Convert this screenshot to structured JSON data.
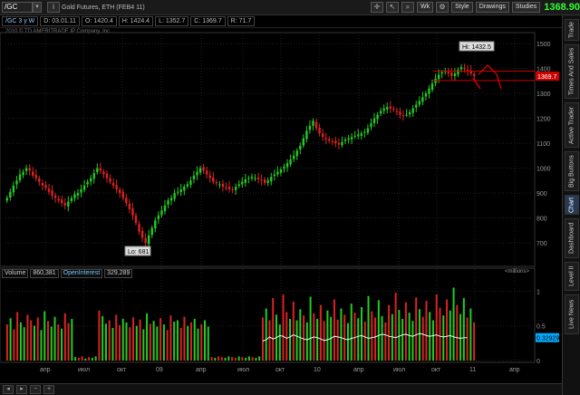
{
  "toolbar": {
    "symbol": "/GC",
    "description": "Gold Futures, ETH (FEB4 11)",
    "period_button": "Wk",
    "style_label": "Style",
    "drawings_label": "Drawings",
    "studies_label": "Studies",
    "last_price": "1368.90",
    "last_price_color": "#33ff33"
  },
  "ohlc": {
    "timeframe": "/GC 3 y W",
    "date": "D: 03.01.11",
    "open": "O: 1420.4",
    "high": "H: 1424.4",
    "low": "L: 1352.7",
    "close": "C: 1369.7",
    "range": "R: 71.7"
  },
  "copyright": "2010 © TD AMERITRADE IP Company, Inc.",
  "sidebar": {
    "tabs": [
      "Trade",
      "Times And Sales",
      "Active Trader",
      "Big Buttons",
      "Chart",
      "Dashboard",
      "Level II",
      "Live News"
    ],
    "active": "Chart"
  },
  "chart_data": [
    {
      "type": "candlestick",
      "title": "",
      "price_axis": {
        "ticks": [
          700,
          800,
          900,
          1000,
          1100,
          1200,
          1300,
          1400,
          1500
        ],
        "ylim": [
          620,
          1530
        ]
      },
      "x_ticks": [
        "апр",
        "июл",
        "окт",
        "09",
        "апр",
        "июл",
        "окт",
        "10",
        "апр",
        "июл",
        "окт",
        "11",
        "апр"
      ],
      "annotations": [
        {
          "text": "Hi: 1432.5",
          "value": 1432.5
        },
        {
          "text": "Lo: 681",
          "value": 681
        }
      ],
      "price_label": "1369.7",
      "horizontal_lines": [
        1390,
        1352
      ],
      "closes": [
        880,
        905,
        930,
        950,
        975,
        985,
        1000,
        990,
        970,
        960,
        945,
        930,
        920,
        905,
        890,
        880,
        870,
        860,
        850,
        865,
        880,
        895,
        900,
        915,
        930,
        945,
        960,
        980,
        1000,
        990,
        975,
        960,
        945,
        930,
        915,
        900,
        880,
        860,
        835,
        810,
        780,
        745,
        720,
        700,
        730,
        760,
        790,
        810,
        830,
        850,
        870,
        880,
        900,
        905,
        915,
        925,
        935,
        950,
        970,
        985,
        1000,
        990,
        975,
        960,
        945,
        940,
        935,
        925,
        920,
        915,
        915,
        925,
        935,
        945,
        955,
        960,
        965,
        960,
        955,
        950,
        940,
        950,
        965,
        975,
        985,
        995,
        1005,
        1020,
        1035,
        1050,
        1070,
        1090,
        1120,
        1150,
        1170,
        1190,
        1160,
        1140,
        1125,
        1115,
        1110,
        1105,
        1100,
        1095,
        1105,
        1115,
        1120,
        1125,
        1130,
        1135,
        1140,
        1145,
        1160,
        1180,
        1200,
        1215,
        1230,
        1240,
        1245,
        1240,
        1235,
        1225,
        1215,
        1210,
        1215,
        1225,
        1240,
        1255,
        1270,
        1285,
        1300,
        1320,
        1340,
        1360,
        1375,
        1385,
        1390,
        1380,
        1370,
        1380,
        1395,
        1405,
        1400,
        1390,
        1380,
        1370
      ]
    },
    {
      "type": "bar",
      "title": "",
      "series": [
        {
          "name": "Volume",
          "value_label": "860,381"
        },
        {
          "name": "OpenInterest",
          "value_label": "329,289"
        }
      ],
      "volume_axis": {
        "ticks": [
          "1",
          "0.5",
          "0"
        ],
        "ylim": [
          0,
          1.2
        ],
        "unit": "<millions>"
      },
      "oi_label": "0.32929",
      "volumes": [
        0.52,
        0.61,
        0.45,
        0.7,
        0.55,
        0.48,
        0.66,
        0.58,
        0.5,
        0.62,
        0.44,
        0.71,
        0.57,
        0.49,
        0.63,
        0.52,
        0.46,
        0.68,
        0.54,
        0.6,
        0.05,
        0.04,
        0.06,
        0.03,
        0.05,
        0.04,
        0.06,
        0.72,
        0.64,
        0.53,
        0.58,
        0.47,
        0.66,
        0.51,
        0.6,
        0.55,
        0.48,
        0.62,
        0.5,
        0.59,
        0.45,
        0.68,
        0.53,
        0.57,
        0.49,
        0.61,
        0.52,
        0.44,
        0.65,
        0.56,
        0.58,
        0.47,
        0.63,
        0.5,
        0.55,
        0.6,
        0.46,
        0.52,
        0.58,
        0.49,
        0.05,
        0.04,
        0.06,
        0.05,
        0.04,
        0.06,
        0.05,
        0.04,
        0.06,
        0.05,
        0.04,
        0.06,
        0.05,
        0.04,
        0.06,
        0.62,
        0.75,
        0.58,
        0.9,
        0.66,
        0.52,
        0.95,
        0.7,
        0.6,
        0.85,
        0.58,
        0.74,
        0.65,
        0.55,
        0.92,
        0.68,
        0.6,
        0.8,
        0.57,
        0.72,
        0.63,
        0.88,
        0.59,
        0.75,
        0.66,
        0.54,
        0.82,
        0.69,
        0.61,
        0.77,
        0.56,
        0.93,
        0.71,
        0.62,
        0.87,
        0.64,
        0.55,
        0.8,
        0.67,
        0.98,
        0.73,
        0.6,
        0.84,
        0.69,
        0.57,
        0.91,
        0.74,
        0.63,
        0.86,
        0.7,
        0.58,
        0.95,
        0.76,
        0.65,
        0.88,
        0.72,
        1.05,
        0.8,
        0.67,
        0.9,
        0.62,
        0.75,
        0.55
      ],
      "open_interest_start_index": 75,
      "open_interest": [
        0.28,
        0.3,
        0.34,
        0.31,
        0.33,
        0.36,
        0.35,
        0.32,
        0.34,
        0.37,
        0.35,
        0.33,
        0.31,
        0.3,
        0.32,
        0.34,
        0.33,
        0.31,
        0.29,
        0.3,
        0.32,
        0.35,
        0.34,
        0.33,
        0.31,
        0.3,
        0.32,
        0.33,
        0.35,
        0.36,
        0.34,
        0.32,
        0.33,
        0.34,
        0.36,
        0.38,
        0.37,
        0.35,
        0.34,
        0.33,
        0.35,
        0.37,
        0.38,
        0.36,
        0.35,
        0.37,
        0.39,
        0.38,
        0.36,
        0.35,
        0.36,
        0.37,
        0.35,
        0.34,
        0.35,
        0.36,
        0.34,
        0.33,
        0.32,
        0.33,
        0.33
      ]
    }
  ],
  "colors": {
    "up": "#22cc22",
    "down": "#dd2222",
    "grid": "#222222",
    "axis_text": "#999999"
  }
}
